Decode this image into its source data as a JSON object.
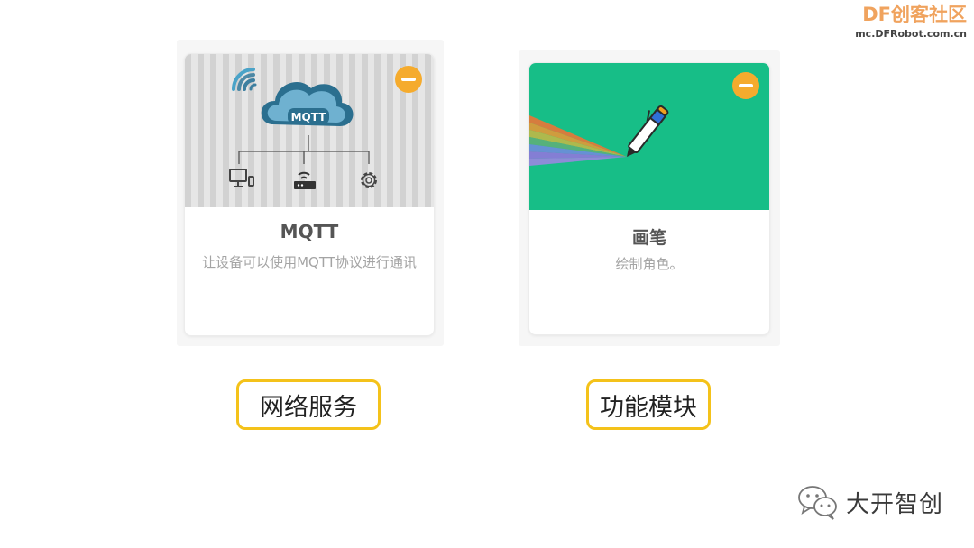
{
  "watermark": {
    "logo": "DF创客社区",
    "url": "mc.DFRobot.com.cn"
  },
  "cards": [
    {
      "title": "MQTT",
      "description": "让设备可以使用MQTT协议进行通讯",
      "image_label": "MQTT",
      "icons": [
        "wifi-icon",
        "cloud-icon",
        "computer-icon",
        "router-icon",
        "gear-icon"
      ],
      "category": "网络服务"
    },
    {
      "title": "画笔",
      "description": "绘制角色。",
      "icons": [
        "pen-icon"
      ],
      "category": "功能模块",
      "accent": "#17be87"
    }
  ],
  "colors": {
    "remove_button": "#f5ab2d",
    "tag_border": "#f4c21a",
    "card_green": "#17be87"
  },
  "footer": {
    "text": "大开智创",
    "icon": "wechat-icon"
  }
}
